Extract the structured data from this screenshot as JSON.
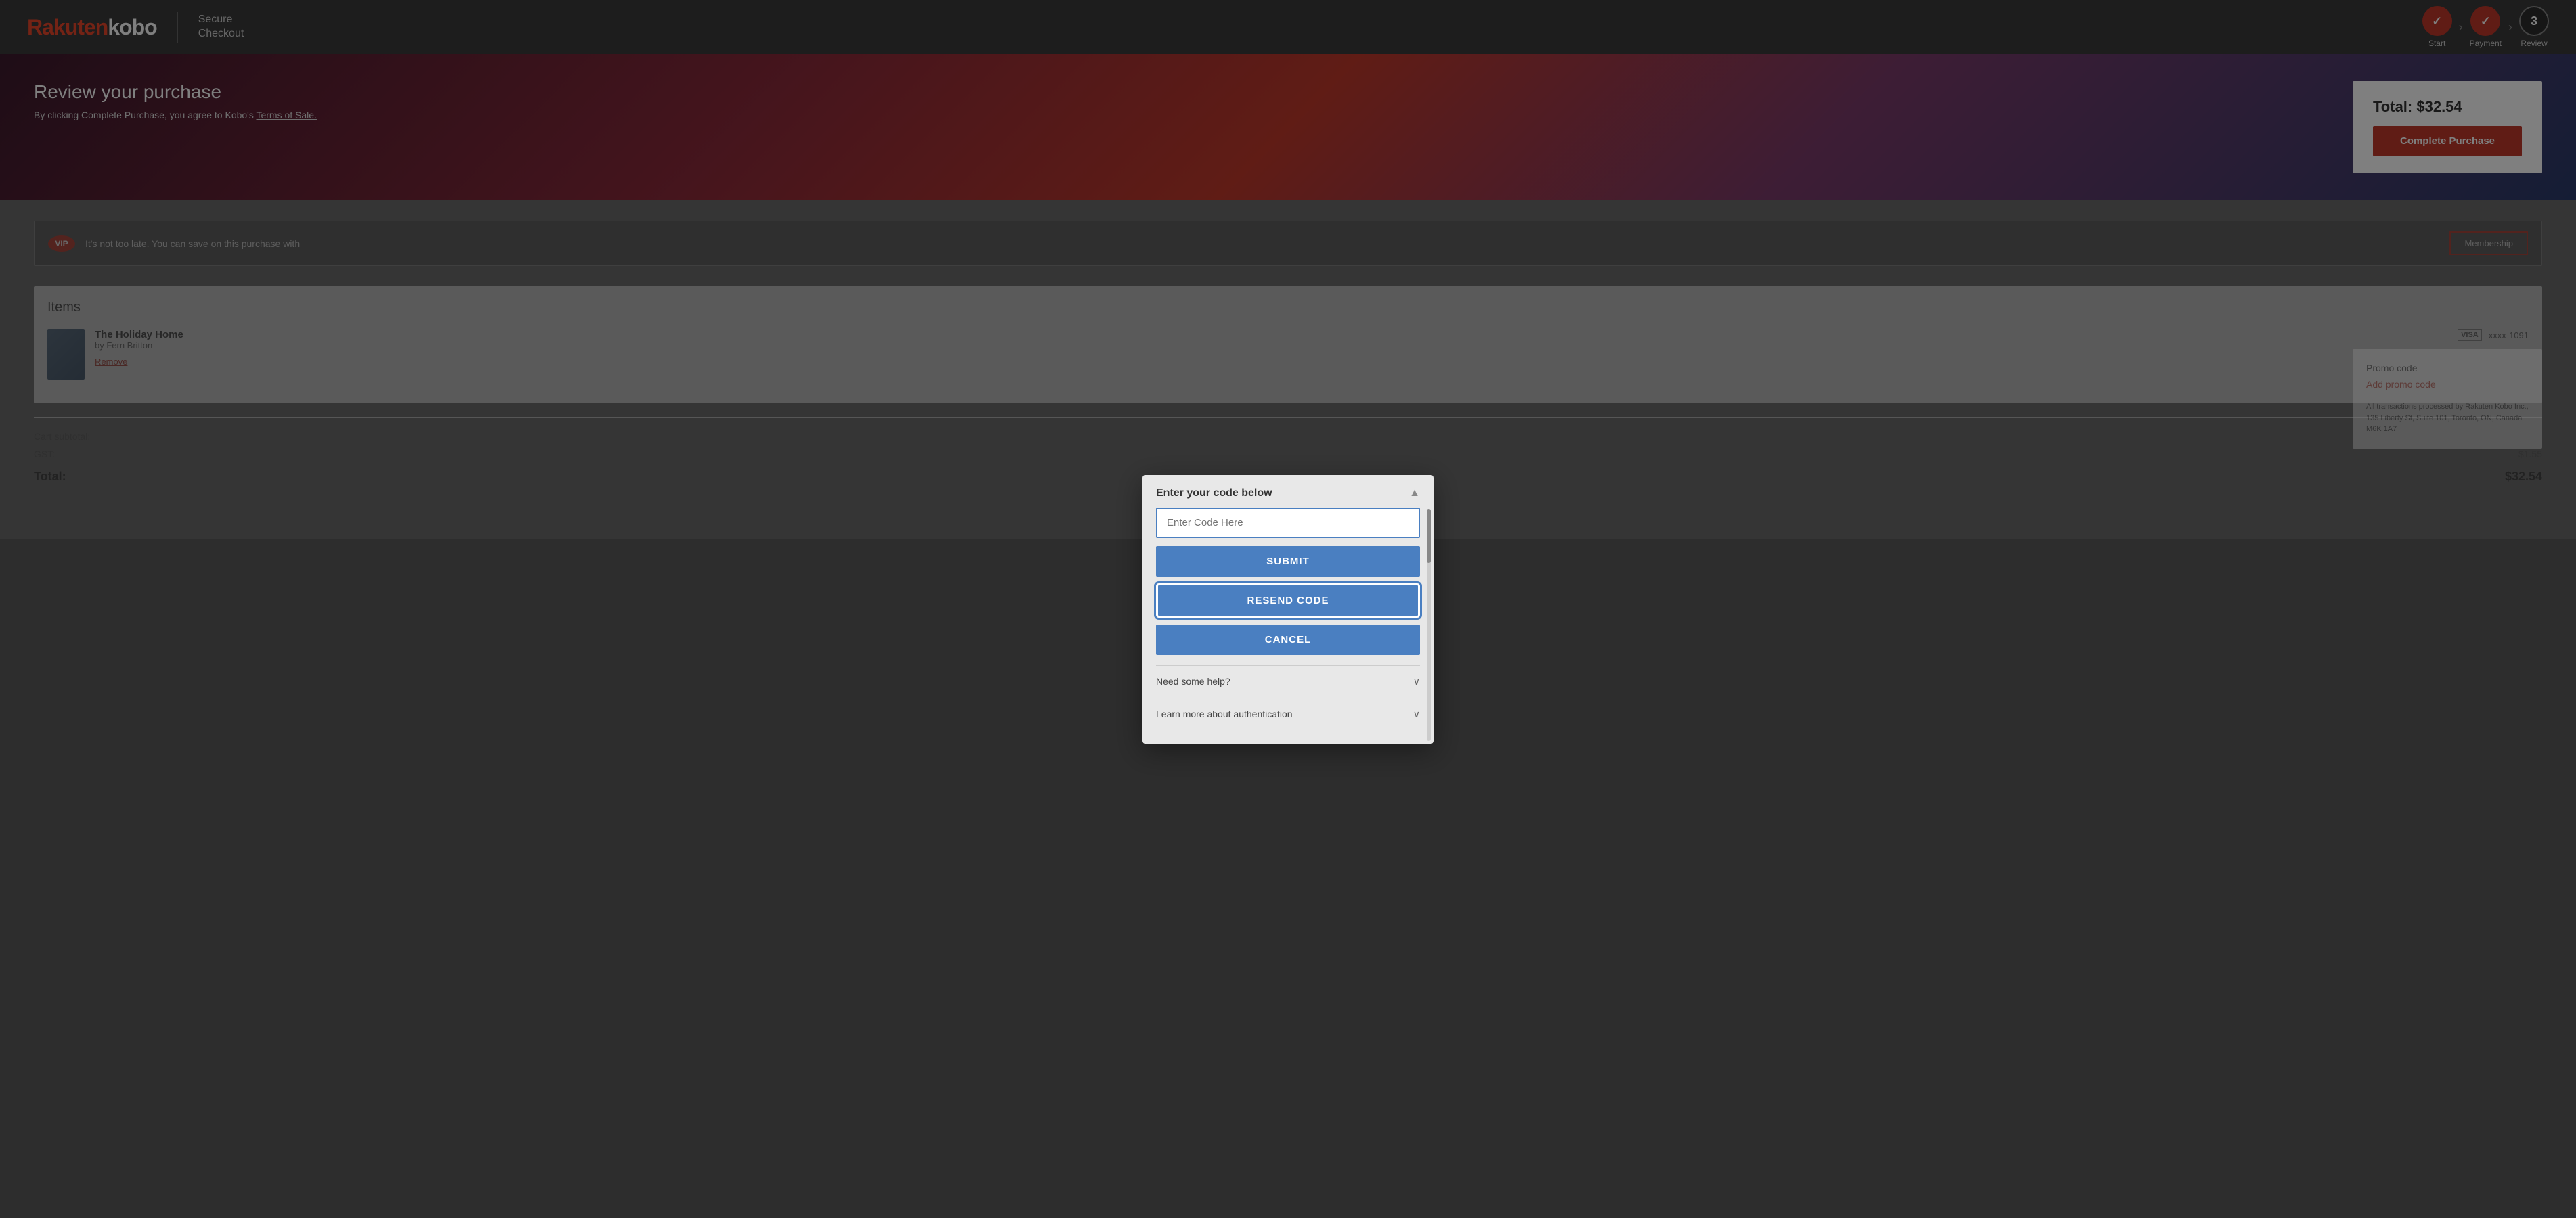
{
  "header": {
    "logo_rakuten": "Rakuten",
    "logo_kobo": "kobo",
    "secure_checkout_line1": "Secure",
    "secure_checkout_line2": "Checkout",
    "steps": [
      {
        "label": "Start",
        "state": "done",
        "icon": "✓"
      },
      {
        "label": "Payment",
        "state": "done",
        "icon": "✓"
      },
      {
        "label": "Review",
        "state": "active",
        "icon": "3"
      }
    ]
  },
  "hero": {
    "title": "Review your purchase",
    "subtitle_prefix": "By clicking Complete Purchase, you agree to Kobo's",
    "terms_link": "Terms of Sale.",
    "order_total": "Total: $32.54",
    "complete_purchase_btn": "Complete Purchase"
  },
  "vip": {
    "badge": "VIP",
    "text": "It's not too late. You can save on this purchase with",
    "membership_btn": "Membership"
  },
  "items": {
    "section_title": "Items",
    "book_title": "The Holiday Home",
    "book_author": "by Fern Britton",
    "remove_label": "Remove",
    "payment_label": "xxxx-1091"
  },
  "totals": {
    "cart_subtotal_label": "Cart subtotal:",
    "gst_label": "GST:",
    "gst_value": "$1.55",
    "total_label": "Total:",
    "total_value": "$32.54"
  },
  "sidebar": {
    "promo_label": "Promo code",
    "add_promo": "Add promo code",
    "transaction_info": "All transactions processed by Rakuten Kobo Inc., 135 Liberty St, Suite 101, Toronto, ON, Canada M6K 1A7"
  },
  "modal": {
    "title": "Enter your code below",
    "code_input_placeholder": "Enter Code Here",
    "submit_btn": "SUBMIT",
    "resend_btn": "RESEND CODE",
    "cancel_btn": "CANCEL",
    "help_label": "Need some help?",
    "auth_label": "Learn more about authentication"
  }
}
